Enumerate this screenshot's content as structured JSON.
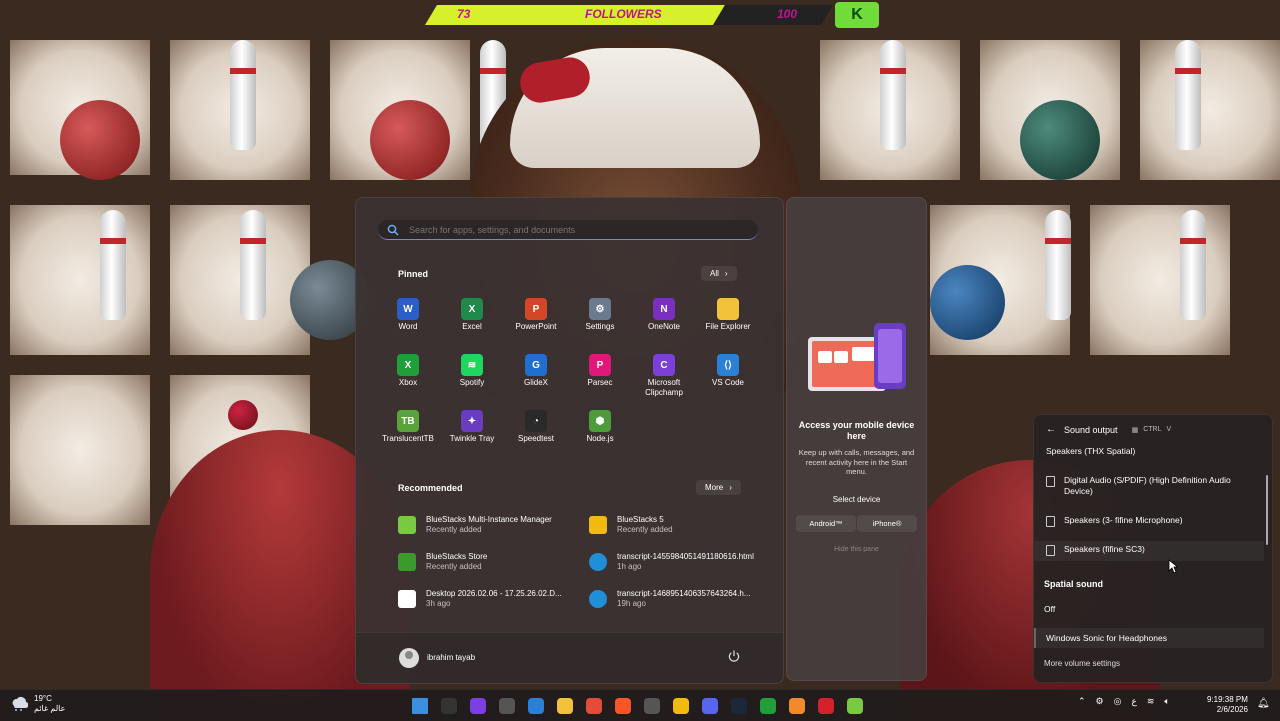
{
  "overlay": {
    "followers_current": "73",
    "followers_label": "FOLLOWERS",
    "followers_goal": "100",
    "badge": "K"
  },
  "start_menu": {
    "search_placeholder": "Search for apps, settings, and documents",
    "pinned_title": "Pinned",
    "all_label": "All",
    "pinned": [
      {
        "label": "Word",
        "icon": "word-icon",
        "color": "#2b5fc7",
        "glyph": "W"
      },
      {
        "label": "Excel",
        "icon": "excel-icon",
        "color": "#1f8a4c",
        "glyph": "X"
      },
      {
        "label": "PowerPoint",
        "icon": "powerpoint-icon",
        "color": "#d24726",
        "glyph": "P"
      },
      {
        "label": "Settings",
        "icon": "gear-icon",
        "color": "#6b7a8f",
        "glyph": "⚙"
      },
      {
        "label": "OneNote",
        "icon": "onenote-icon",
        "color": "#7b2fbf",
        "glyph": "N"
      },
      {
        "label": "File Explorer",
        "icon": "folder-icon",
        "color": "#f2c23a",
        "glyph": ""
      },
      {
        "label": "Xbox",
        "icon": "xbox-icon",
        "color": "#1f9e3a",
        "glyph": "X"
      },
      {
        "label": "Spotify",
        "icon": "spotify-icon",
        "color": "#1ed760",
        "glyph": "≋"
      },
      {
        "label": "GlideX",
        "icon": "glidex-icon",
        "color": "#1e6fd0",
        "glyph": "G"
      },
      {
        "label": "Parsec",
        "icon": "parsec-icon",
        "color": "#e0187a",
        "glyph": "P"
      },
      {
        "label": "Microsoft Clipchamp",
        "icon": "clipchamp-icon",
        "color": "#7c3fd9",
        "glyph": "C"
      },
      {
        "label": "VS Code",
        "icon": "vscode-icon",
        "color": "#2a7fd6",
        "glyph": "⟨⟩"
      },
      {
        "label": "TranslucentTB",
        "icon": "translucenttb-icon",
        "color": "#5aa33a",
        "glyph": "TB"
      },
      {
        "label": "Twinkle Tray",
        "icon": "twinkle-tray-icon",
        "color": "#6a3cc0",
        "glyph": "✦"
      },
      {
        "label": "Speedtest",
        "icon": "speedtest-icon",
        "color": "#2a2a2a",
        "glyph": "◔"
      },
      {
        "label": "Node.js",
        "icon": "nodejs-icon",
        "color": "#4d9b3a",
        "glyph": "⬢"
      }
    ],
    "recommended_title": "Recommended",
    "more_label": "More",
    "recommended": [
      {
        "name": "BlueStacks Multi-Instance Manager",
        "sub": "Recently added",
        "icon": "bluestacks-multi-icon",
        "color": "#7ac943"
      },
      {
        "name": "BlueStacks 5",
        "sub": "Recently added",
        "icon": "bluestacks-icon",
        "color": "#f2b90f"
      },
      {
        "name": "BlueStacks Store",
        "sub": "Recently added",
        "icon": "bluestacks-store-icon",
        "color": "#3b9a2c"
      },
      {
        "name": "transcript-1455984051491180616.html",
        "sub": "1h ago",
        "icon": "edge-icon",
        "color": "#1f8fd8"
      },
      {
        "name": "Desktop 2026.02.06 - 17.25.26.02.D...",
        "sub": "3h ago",
        "icon": "video-file-icon",
        "color": "#ffffff"
      },
      {
        "name": "transcript-1468951406357643264.h...",
        "sub": "19h ago",
        "icon": "edge-icon",
        "color": "#1f8fd8"
      }
    ],
    "user_name": "ibrahim tayab"
  },
  "phone_panel": {
    "title": "Access your mobile device here",
    "description": "Keep up with calls, messages, and recent activity here in the Start menu.",
    "select_label": "Select device",
    "android": "Android™",
    "iphone": "iPhone®",
    "hide": "Hide this pane"
  },
  "sound": {
    "title": "Sound output",
    "kbd_ctrl": "CTRL",
    "kbd_v": "V",
    "devices": [
      "Speakers (THX Spatial)",
      "Digital Audio (S/PDIF) (High Definition Audio Device)",
      "Speakers (3- fifine Microphone)",
      "Speakers (fifine SC3)"
    ],
    "spatial_title": "Spatial sound",
    "spatial_options": [
      "Off",
      "Windows Sonic for Headphones"
    ],
    "more_settings": "More volume settings"
  },
  "taskbar": {
    "temperature": "19°C",
    "weather_text": "عالم غائم",
    "language": "ع",
    "time": "9:19:38 PM",
    "date": "2/6/2026",
    "apps": [
      {
        "icon": "windows-start-icon",
        "color": "#3b8fe0"
      },
      {
        "icon": "obs-icon",
        "color": "#333333"
      },
      {
        "icon": "chrome-like-icon",
        "color": "#7b3fe4"
      },
      {
        "icon": "settings-taskbar-icon",
        "color": "#555555"
      },
      {
        "icon": "calculator-icon",
        "color": "#2b7fd8"
      },
      {
        "icon": "folder-taskbar-icon",
        "color": "#f2c23a"
      },
      {
        "icon": "chrome-icon",
        "color": "#e44b3a"
      },
      {
        "icon": "brave-icon",
        "color": "#fb542b"
      },
      {
        "icon": "store-icon",
        "color": "#555555"
      },
      {
        "icon": "emoji-icon",
        "color": "#f2b90f"
      },
      {
        "icon": "discord-icon",
        "color": "#5865f2"
      },
      {
        "icon": "steam-icon",
        "color": "#1b2838"
      },
      {
        "icon": "xbox-taskbar-icon",
        "color": "#1f9e3a"
      },
      {
        "icon": "app-a-icon",
        "color": "#f08a2a"
      },
      {
        "icon": "app-red-icon",
        "color": "#d3222a"
      },
      {
        "icon": "bluestacks-taskbar-icon",
        "color": "#7ac943"
      }
    ]
  }
}
